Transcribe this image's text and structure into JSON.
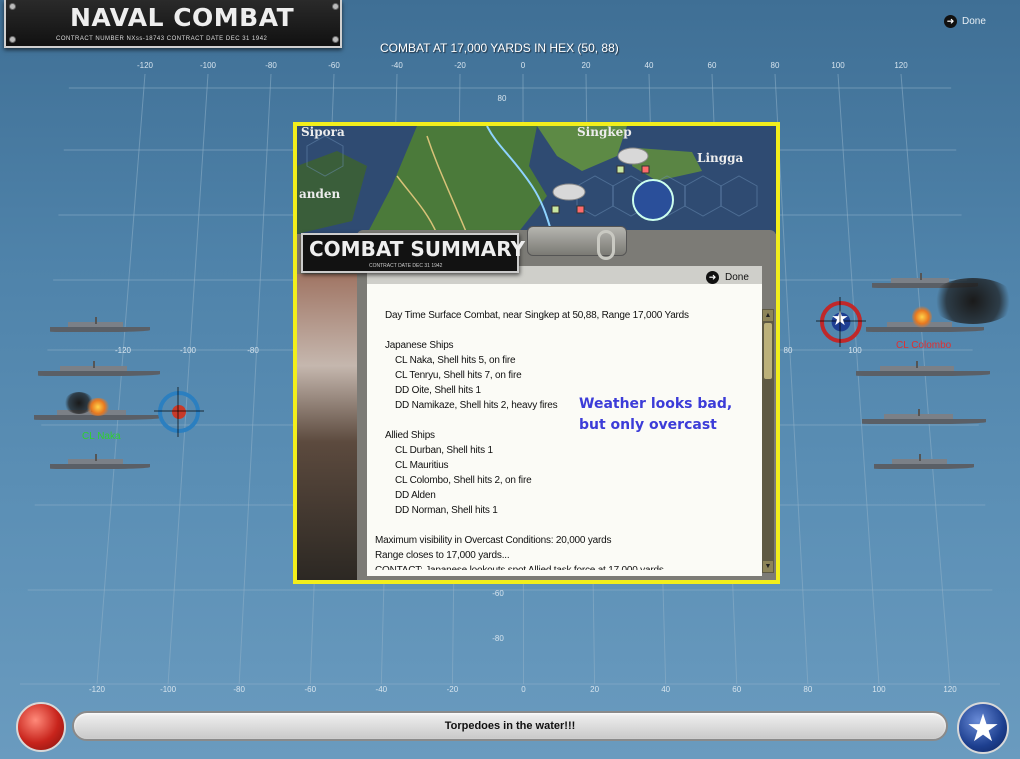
{
  "header": {
    "title": "NAVAL COMBAT",
    "contract_line": "CONTRACT NUMBER  NXss-18743        CONTRACT DATE DEC 31 1942",
    "combat_heading": "COMBAT AT 17,000 YARDS IN HEX (50, 88)",
    "done_label": "Done"
  },
  "grid": {
    "top_labels": [
      "-120",
      "-100",
      "-80",
      "-60",
      "-40",
      "-20",
      "0",
      "20",
      "40",
      "60",
      "80",
      "100",
      "120"
    ],
    "bottom_labels": [
      "-120",
      "-100",
      "-80",
      "-60",
      "-40",
      "-20",
      "0",
      "20",
      "40",
      "60",
      "80",
      "100",
      "120"
    ],
    "mid_labels": [
      "-120",
      "-100",
      "-80"
    ],
    "right_mid_labels": [
      "80",
      "100"
    ],
    "y_labels": [
      "80",
      "-60",
      "-80"
    ]
  },
  "map": {
    "places": [
      "Sipora",
      "Singkep",
      "Lingga",
      "anden"
    ]
  },
  "ships": {
    "japanese_label": "CL Naka",
    "allied_label": "CL Colombo",
    "japanese_label_color": "#2fd02f",
    "allied_label_color": "#e03030"
  },
  "summary": {
    "plate_title": "COMBAT SUMMARY",
    "plate_sub": "CONTRACT DATE DEC 31 1942",
    "done_label": "Done",
    "lines": [
      {
        "text": "Day Time Surface Combat, near Singkep at 50,88, Range 17,000 Yards",
        "indent": 1
      },
      {
        "text": "",
        "indent": 0
      },
      {
        "text": "Japanese Ships",
        "indent": 1
      },
      {
        "text": "CL Naka, Shell hits 5,  on fire",
        "indent": 2
      },
      {
        "text": "CL Tenryu, Shell hits 7,  on fire",
        "indent": 2
      },
      {
        "text": "DD Oite, Shell hits 1",
        "indent": 2
      },
      {
        "text": "DD Namikaze, Shell hits 2,  heavy fires",
        "indent": 2
      },
      {
        "text": "",
        "indent": 0
      },
      {
        "text": "Allied Ships",
        "indent": 1
      },
      {
        "text": "CL Durban, Shell hits 1",
        "indent": 2
      },
      {
        "text": "CL Mauritius",
        "indent": 2
      },
      {
        "text": "CL Colombo, Shell hits 2,  on fire",
        "indent": 2
      },
      {
        "text": "DD Alden",
        "indent": 2
      },
      {
        "text": "DD Norman, Shell hits 1",
        "indent": 2
      },
      {
        "text": "",
        "indent": 0
      },
      {
        "text": "Maximum visibility in Overcast Conditions: 20,000 yards",
        "indent": 0
      },
      {
        "text": "Range closes to 17,000 yards...",
        "indent": 0
      },
      {
        "text": "CONTACT: Japanese lookouts spot Allied task force at 17,000 yards",
        "indent": 0
      }
    ],
    "note_line1": "Weather looks bad,",
    "note_line2": "but only overcast"
  },
  "status": {
    "message": "Torpedoes in the water!!!"
  }
}
